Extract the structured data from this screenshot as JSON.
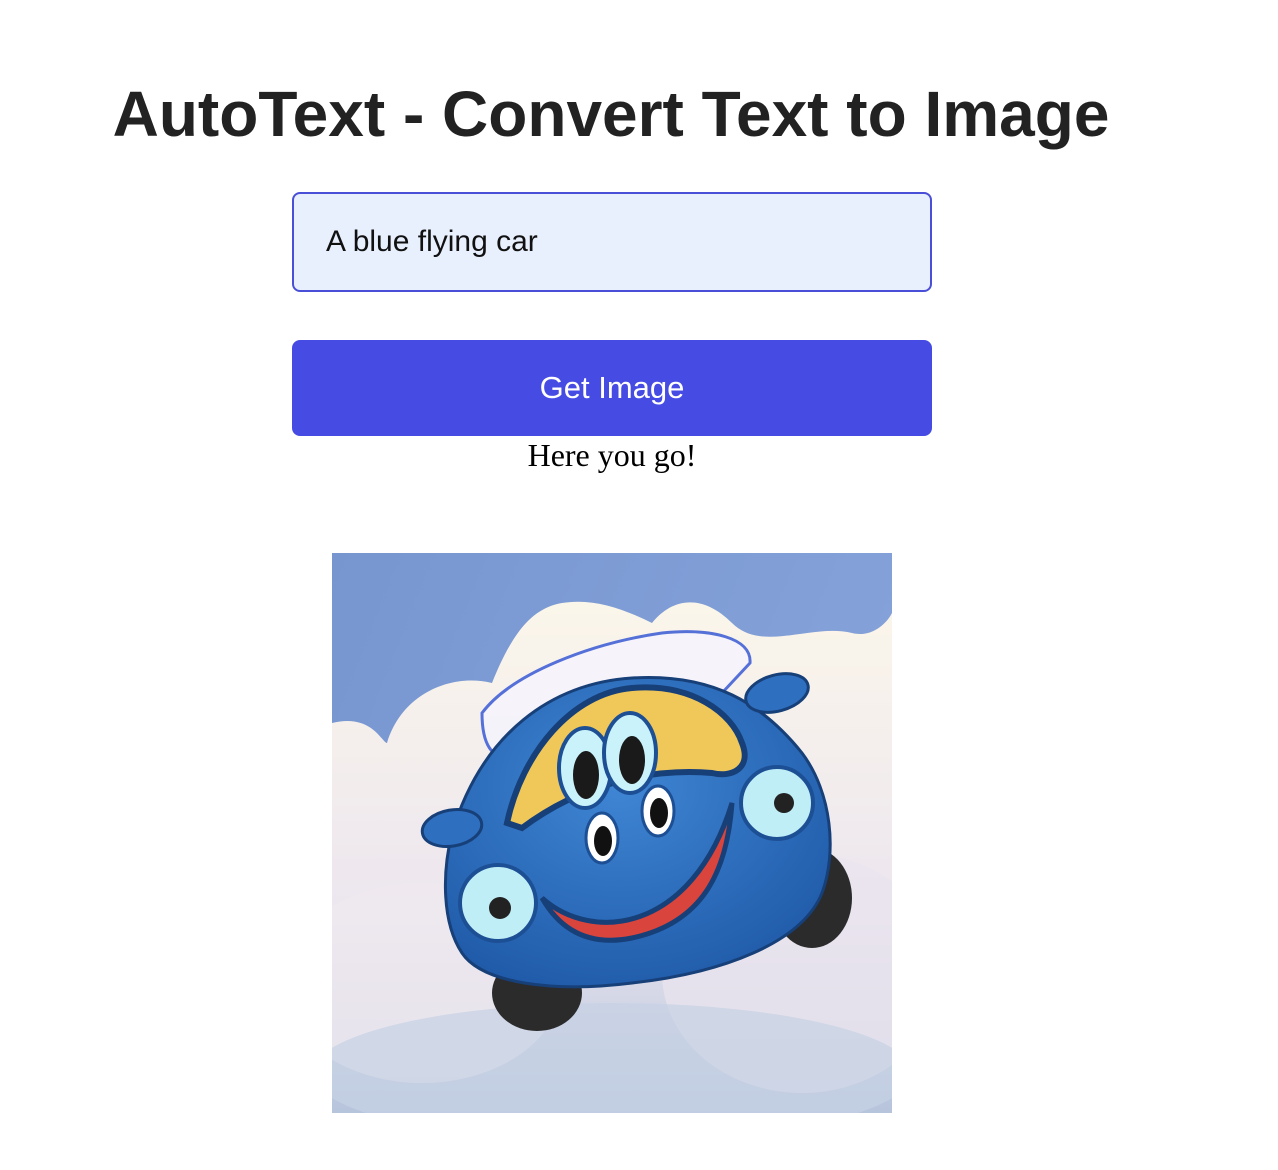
{
  "page": {
    "title": "AutoText - Convert Text to Image"
  },
  "form": {
    "prompt_value": "A blue flying car",
    "submit_label": "Get Image"
  },
  "result": {
    "status_text": "Here you go!",
    "image_subject": "cartoon blue flying car among clouds"
  },
  "colors": {
    "accent": "#464be3",
    "input_background": "#e8effd",
    "input_border": "#4a4fd8",
    "title_text": "#222222"
  }
}
